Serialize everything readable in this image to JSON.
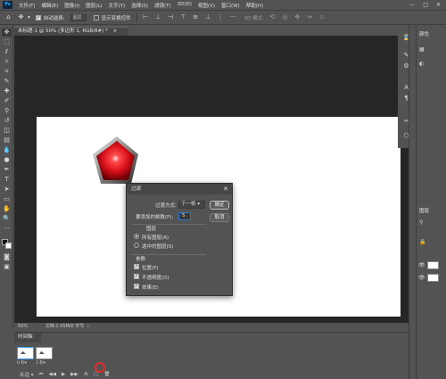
{
  "app": {
    "logo_text": "Ps"
  },
  "menu": [
    "文件(F)",
    "编辑(E)",
    "图像(I)",
    "图层(L)",
    "文字(Y)",
    "选择(S)",
    "滤镜(T)",
    "3D(D)",
    "视图(V)",
    "窗口(W)",
    "帮助(H)"
  ],
  "window_controls": {
    "minimize": "—",
    "maximize": "□",
    "close": "✕"
  },
  "options_bar": {
    "auto_select_label": "自动选择:",
    "auto_select_value": "图层",
    "transform_label": "显示变换控件",
    "mode_3d": "3D 模式:"
  },
  "document_tab": {
    "title": "未标题-1 @ 50% (多边形 1, RGB/8#) *",
    "close": "×"
  },
  "status_bar": {
    "zoom": "50%",
    "doc_info": "文档:1.05M/0 字节"
  },
  "timeline": {
    "tab_label": "时间轴",
    "frames": [
      {
        "duration": "0 秒▾"
      },
      {
        "duration": "1 秒▾"
      }
    ],
    "loop": "永远 ▾"
  },
  "panels": {
    "tab_color": "颜色",
    "tab_layers": "图层",
    "layers": [
      {
        "name": "多边形 1"
      },
      {
        "name": "背景"
      }
    ]
  },
  "dialog": {
    "title": "过滤",
    "method_label": "过渡方式:",
    "method_value": "下一帧",
    "frames_label": "要添加的帧数(F):",
    "frames_value": "5",
    "layers_group": "图层",
    "all_layers": "所有图层(A)",
    "selected_layers": "选中的图层(S)",
    "params_group": "参数",
    "position": "位置(P)",
    "opacity": "不透明度(O)",
    "effects": "效果(E)",
    "ok": "确定",
    "cancel": "取消"
  },
  "colors": {
    "accent": "#2f7bd3",
    "annotation": "#e02b2b",
    "pentagon_red": "#d8101a"
  }
}
